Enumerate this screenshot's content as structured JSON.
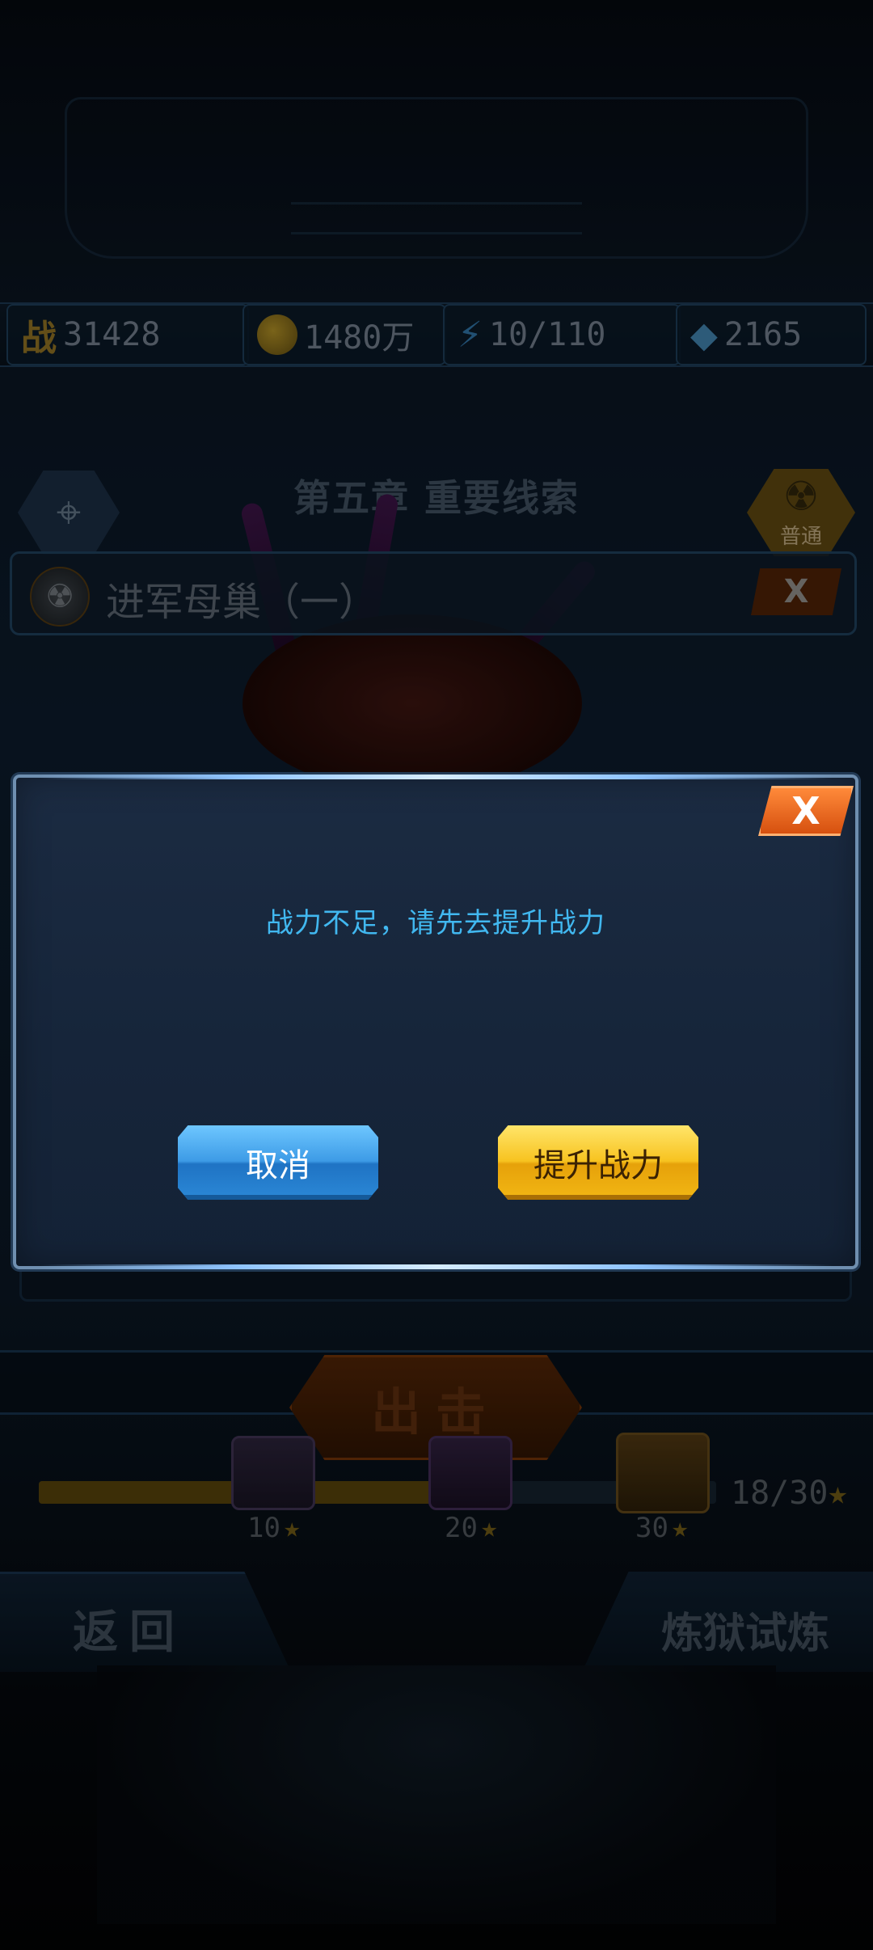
{
  "resources": {
    "power_icon": "战",
    "power": "31428",
    "gold": "1480万",
    "energy": "10/110",
    "gems": "2165"
  },
  "chapter_title": "第五章 重要线索",
  "difficulty_label": "普通",
  "stage_name": "进军母巢（一）",
  "stage_close": "X",
  "deploy_label": "出击",
  "star_rewards": {
    "progress_fraction": 0.6,
    "count": "18/30",
    "milestones": [
      "10",
      "20",
      "30"
    ]
  },
  "bottom_nav": {
    "back": "返回",
    "trial": "炼狱试炼"
  },
  "dialog": {
    "close": "X",
    "message": "战力不足，请先去提升战力",
    "cancel": "取消",
    "confirm": "提升战力"
  },
  "colors": {
    "message": "#41b8f0",
    "cancel_button": "#3d9be6",
    "confirm_button": "#f7c320",
    "close_button": "#e8651f"
  },
  "icons": [
    "power-icon",
    "coin-icon",
    "lightning-icon",
    "diamond-icon",
    "map-icon",
    "radiation-icon",
    "star-icon",
    "close-icon"
  ]
}
